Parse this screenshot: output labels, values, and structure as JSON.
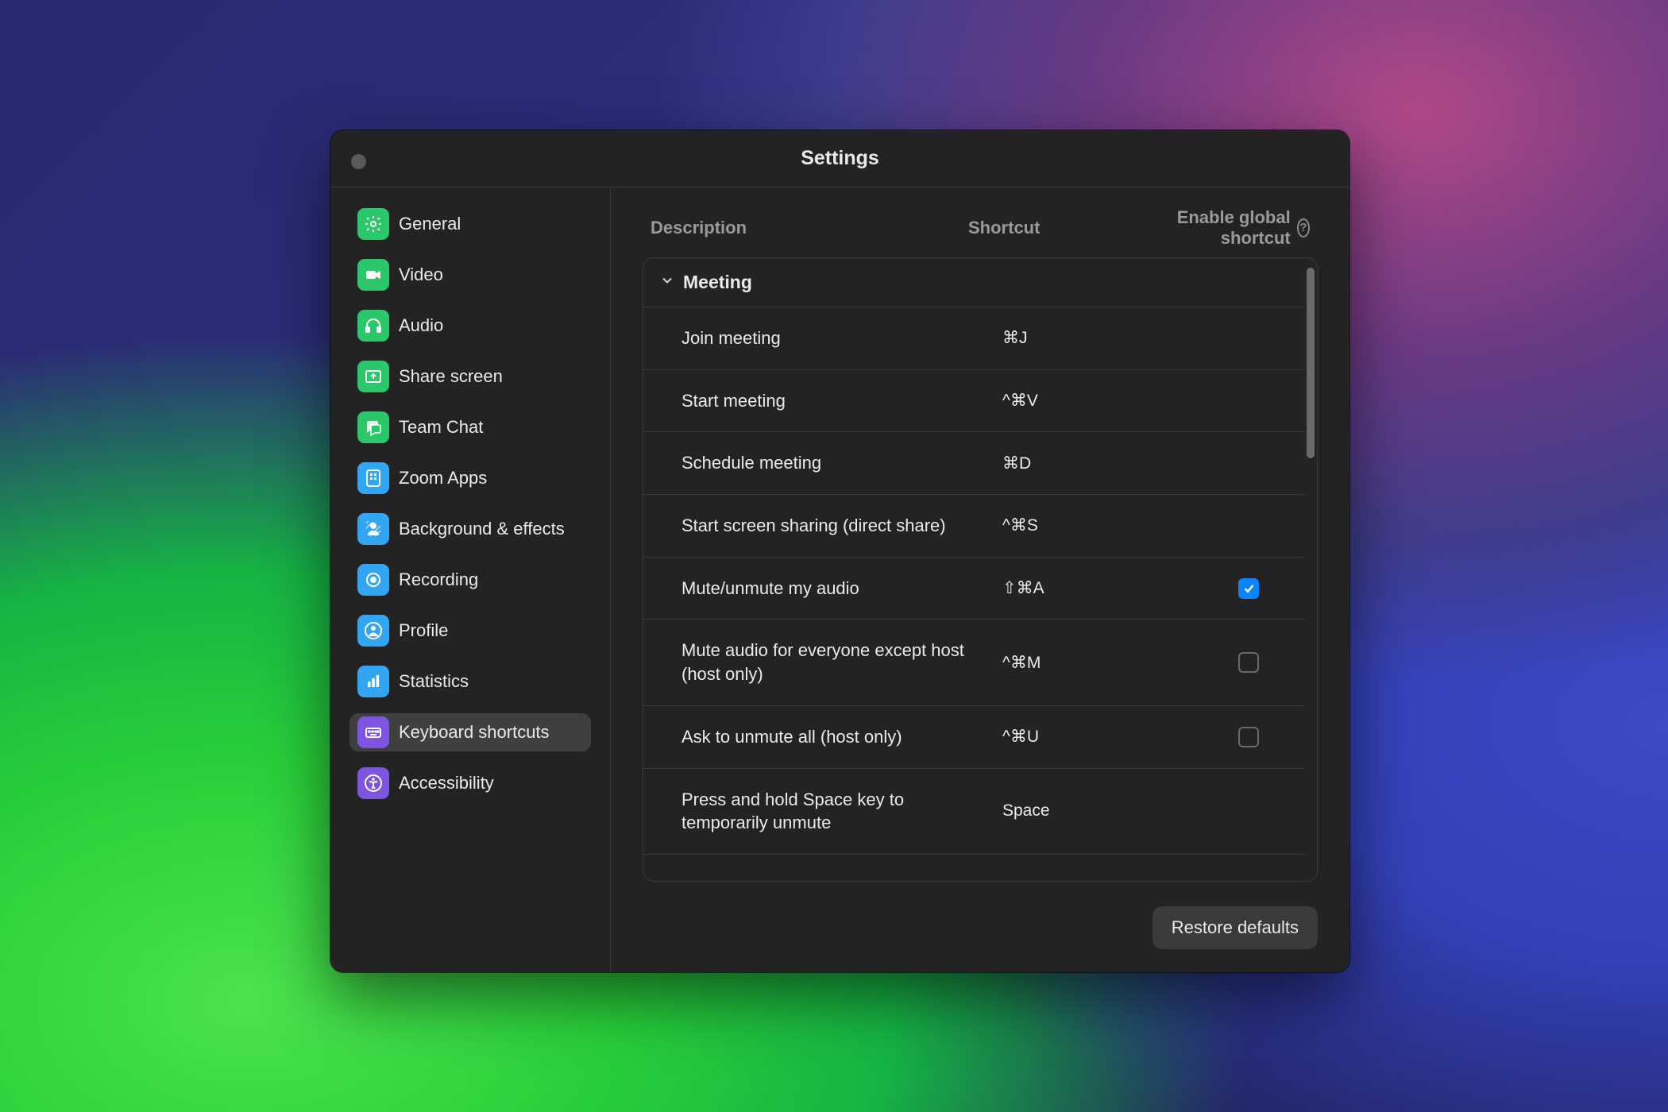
{
  "window": {
    "title": "Settings"
  },
  "sidebar": {
    "items": [
      {
        "id": "general",
        "label": "General",
        "icon": "gear",
        "color": "#2bc76a"
      },
      {
        "id": "video",
        "label": "Video",
        "icon": "video",
        "color": "#2bc76a"
      },
      {
        "id": "audio",
        "label": "Audio",
        "icon": "headphones",
        "color": "#2bc76a"
      },
      {
        "id": "share-screen",
        "label": "Share screen",
        "icon": "sharescreen",
        "color": "#2bc76a"
      },
      {
        "id": "team-chat",
        "label": "Team Chat",
        "icon": "chat",
        "color": "#2bc76a"
      },
      {
        "id": "zoom-apps",
        "label": "Zoom Apps",
        "icon": "apps",
        "color": "#32a6f2"
      },
      {
        "id": "background-effects",
        "label": "Background & effects",
        "icon": "background",
        "color": "#32a6f2"
      },
      {
        "id": "recording",
        "label": "Recording",
        "icon": "record",
        "color": "#32a6f2"
      },
      {
        "id": "profile",
        "label": "Profile",
        "icon": "profile",
        "color": "#32a6f2"
      },
      {
        "id": "statistics",
        "label": "Statistics",
        "icon": "stats",
        "color": "#32a6f2"
      },
      {
        "id": "keyboard-shortcuts",
        "label": "Keyboard shortcuts",
        "icon": "keyboard",
        "color": "#7d55e0"
      },
      {
        "id": "accessibility",
        "label": "Accessibility",
        "icon": "accessibility",
        "color": "#7d55e0"
      }
    ],
    "selected_id": "keyboard-shortcuts"
  },
  "headers": {
    "description": "Description",
    "shortcut": "Shortcut",
    "enable_global": "Enable global shortcut"
  },
  "section": {
    "title": "Meeting",
    "expanded": true
  },
  "rows": [
    {
      "desc": "Join meeting",
      "shortcut": "⌘J",
      "global": null
    },
    {
      "desc": "Start meeting",
      "shortcut": "^⌘V",
      "global": null
    },
    {
      "desc": "Schedule meeting",
      "shortcut": "⌘D",
      "global": null
    },
    {
      "desc": "Start screen sharing (direct share)",
      "shortcut": "^⌘S",
      "global": null
    },
    {
      "desc": "Mute/unmute my audio",
      "shortcut": "⇧⌘A",
      "global": true
    },
    {
      "desc": "Mute audio for everyone except host (host only)",
      "shortcut": "^⌘M",
      "global": false
    },
    {
      "desc": "Ask to unmute all (host only)",
      "shortcut": "^⌘U",
      "global": false
    },
    {
      "desc": "Press and hold Space key to temporarily unmute",
      "shortcut": "Space",
      "global": null
    }
  ],
  "footer": {
    "restore_defaults": "Restore defaults"
  }
}
